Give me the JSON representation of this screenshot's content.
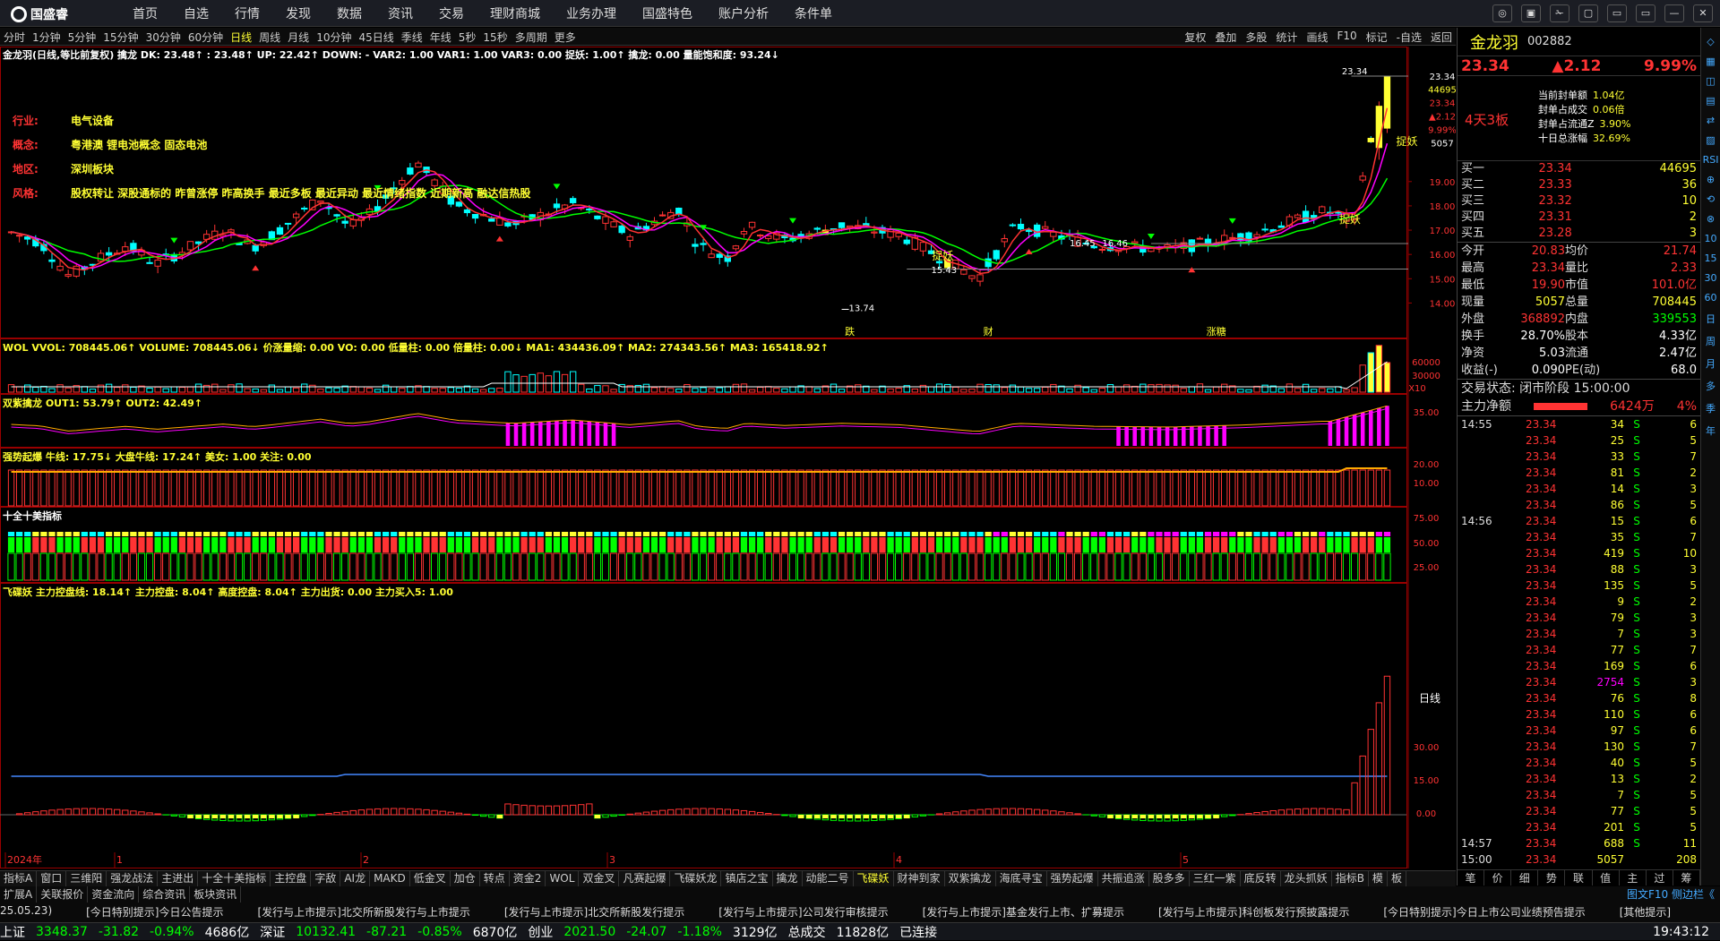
{
  "menu": {
    "app_name": "国盛睿",
    "items": [
      "首页",
      "自选",
      "行情",
      "发现",
      "数据",
      "资讯",
      "交易",
      "理财商城",
      "业务办理",
      "国盛特色",
      "账户分析",
      "条件单"
    ],
    "window_controls": [
      "◎",
      "▣",
      "✁",
      "▢",
      "▭",
      "▭",
      "—",
      "✕"
    ]
  },
  "toolbar": {
    "periods": [
      "分时",
      "1分钟",
      "5分钟",
      "15分钟",
      "30分钟",
      "60分钟",
      "日线",
      "周线",
      "月线",
      "10分钟",
      "45日线",
      "季线",
      "年线",
      "5秒",
      "15秒",
      "多周期",
      "更多"
    ],
    "active_period": "日线",
    "tools": [
      "复权",
      "叠加",
      "多股",
      "统计",
      "画线",
      "F10",
      "标记",
      "-自选",
      "返回"
    ]
  },
  "main_header": "金龙羽(日线,等比前复权)  擒龙  DK: 23.48↑ : 23.48↑ UP: 22.42↑ DOWN: - VAR2: 1.00 VAR1: 1.00 VAR3: 0.00 捉妖: 1.00↑ 擒龙: 0.00 量能饱和度: 93.24↓",
  "stock_info": [
    {
      "k": "行业:",
      "v": "电气设备"
    },
    {
      "k": "概念:",
      "v": "粤港澳 锂电池概念 固态电池"
    },
    {
      "k": "地区:",
      "v": "深圳板块"
    },
    {
      "k": "风格:",
      "v": "股权转让 深股通标的 昨曾涨停 昨高换手 最近多板 最近异动 最近情绪指数 近期新高 融达信热股"
    }
  ],
  "price_axis": [
    "23.34",
    "44695",
    "23.34",
    "▲2.12",
    "9.99%",
    "5057",
    "19.00",
    "18.00",
    "17.00",
    "16.00",
    "15.00",
    "14.00"
  ],
  "annotations": {
    "high": "23.34",
    "low": "13.74",
    "zhuoyao": "捉妖",
    "p1": "15.43",
    "p2": "16.45",
    "p3": "16.46",
    "events": [
      "跌",
      "财",
      "涨糖"
    ],
    "xaxis": [
      "2024年",
      "1",
      "2",
      "3",
      "4",
      "5"
    ],
    "right_label": "日线",
    "vol_x": "X10"
  },
  "indicators": [
    {
      "name": "WOL",
      "text": "WOL  VVOL: 708445.06↑ VOLUME: 708445.06↓ 价涨量缩: 0.00 VO: 0.00 低量柱: 0.00 倍量柱: 0.00↓ MA1: 434436.09↑ MA2: 274343.56↑ MA3: 165418.92↑",
      "axis": [
        "60000",
        "30000"
      ]
    },
    {
      "name": "双紫擒龙",
      "text": "双紫擒龙  OUT1: 53.79↑ OUT2: 42.49↑",
      "axis": [
        "35.00"
      ]
    },
    {
      "name": "强势起爆",
      "text": "强势起爆  牛线: 17.75↓ 大盘牛线: 17.24↑ 美女: 1.00 关注: 0.00",
      "axis": [
        "20.00",
        "10.00"
      ]
    },
    {
      "name": "十全十美指标",
      "text": "十全十美指标",
      "axis": [
        "75.00",
        "50.00",
        "25.00"
      ]
    },
    {
      "name": "飞碟妖",
      "text": "飞碟妖  主力控盘线: 18.14↑ 主力控盘: 8.04↑ 高度控盘: 8.04↑ 主力出货: 0.00 主力买入5: 1.00",
      "axis": [
        "30.00",
        "15.00",
        "0.00"
      ]
    }
  ],
  "func_tabs": [
    "指标A",
    "窗口",
    "三维阳",
    "强龙战法",
    "主进出",
    "十全十美指标",
    "主控盘",
    "字敌",
    "AI龙",
    "MAKD",
    "低金叉",
    "加仓",
    "转点",
    "资金2",
    "WOL",
    "双金叉",
    "凡赛起爆",
    "飞碟妖龙",
    "镇店之宝",
    "擒龙",
    "动能二号",
    "飞碟妖",
    "财神到家",
    "双紫擒龙",
    "海底寻宝",
    "强势起爆",
    "共振追涨",
    "股多多",
    "三红一紫",
    "底反转",
    "龙头抓妖",
    "指标B",
    "模",
    "板"
  ],
  "func_active": "飞碟妖",
  "news_tabs": [
    "扩展A",
    "关联报价",
    "资金流向",
    "综合资讯",
    "板块资讯"
  ],
  "news_active": "综合资讯",
  "news_date": "25.05.23)",
  "news": [
    "[今日特别提示]今日公告提示",
    "[发行与上市提示]北交所新股发行与上市提示",
    "[发行与上市提示]北交所新股发行提示",
    "[发行与上市提示]公司发行审核提示",
    "[发行与上市提示]基金发行上市、扩募提示",
    "[发行与上市提示]科创板发行预披露提示",
    "[今日特别提示]今日上市公司业绩预告提示",
    "[其他提示]"
  ],
  "news_right": "图文F10 侧边栏《",
  "status": [
    {
      "label": "上证",
      "val": "3348.37",
      "chg": "-31.82",
      "pct": "-0.94%",
      "amt": "4686亿"
    },
    {
      "label": "深证",
      "val": "10132.41",
      "chg": "-87.21",
      "pct": "-0.85%",
      "amt": "6870亿"
    },
    {
      "label": "创业",
      "val": "2021.50",
      "chg": "-24.07",
      "pct": "-1.18%",
      "amt": "3129亿"
    }
  ],
  "status_total": {
    "label": "总成交",
    "amt": "11828亿"
  },
  "status_conn": "已连接",
  "status_time": "19:43:12",
  "quote": {
    "name": "金龙羽",
    "code": "002882",
    "price": "23.34",
    "change": "▲2.12",
    "pct": "9.99%",
    "days_text": "4天3板",
    "seal": [
      {
        "k": "当前封单额",
        "v": "1.04亿"
      },
      {
        "k": "封单占成交",
        "v": "0.06倍"
      },
      {
        "k": "封单占流通Z",
        "v": "3.90%"
      },
      {
        "k": "十日总涨幅",
        "v": "32.69%"
      }
    ],
    "bids": [
      {
        "l": "买一",
        "p": "23.34",
        "v": "44695"
      },
      {
        "l": "买二",
        "p": "23.33",
        "v": "36"
      },
      {
        "l": "买三",
        "p": "23.32",
        "v": "10"
      },
      {
        "l": "买四",
        "p": "23.31",
        "v": "2"
      },
      {
        "l": "买五",
        "p": "23.28",
        "v": "3"
      }
    ],
    "stats": [
      [
        "今开",
        "20.83",
        "均价",
        "21.74"
      ],
      [
        "最高",
        "23.34",
        "量比",
        "2.33"
      ],
      [
        "最低",
        "19.90",
        "市值",
        "101.0亿"
      ],
      [
        "现量",
        "5057",
        "总量",
        "708445"
      ],
      [
        "外盘",
        "368892",
        "内盘",
        "339553"
      ],
      [
        "换手",
        "28.70%",
        "股本",
        "4.33亿"
      ],
      [
        "净资",
        "5.03",
        "流通",
        "2.47亿"
      ],
      [
        "收益(-)",
        "0.090",
        "PE(动)",
        "68.0"
      ]
    ],
    "state": "交易状态: 闭市阶段 15:00:00",
    "main_net": {
      "label": "主力净额",
      "val": "6424万",
      "pct": "4%"
    },
    "ticks": [
      [
        "14:55",
        "23.34",
        "34",
        "S",
        "6"
      ],
      [
        "",
        "23.34",
        "25",
        "S",
        "5"
      ],
      [
        "",
        "23.34",
        "33",
        "S",
        "7"
      ],
      [
        "",
        "23.34",
        "81",
        "S",
        "2"
      ],
      [
        "",
        "23.34",
        "14",
        "S",
        "3"
      ],
      [
        "",
        "23.34",
        "86",
        "S",
        "5"
      ],
      [
        "14:56",
        "23.34",
        "15",
        "S",
        "6"
      ],
      [
        "",
        "23.34",
        "35",
        "S",
        "7"
      ],
      [
        "",
        "23.34",
        "419",
        "S",
        "10"
      ],
      [
        "",
        "23.34",
        "88",
        "S",
        "3"
      ],
      [
        "",
        "23.34",
        "135",
        "S",
        "5"
      ],
      [
        "",
        "23.34",
        "9",
        "S",
        "2"
      ],
      [
        "",
        "23.34",
        "79",
        "S",
        "3"
      ],
      [
        "",
        "23.34",
        "7",
        "S",
        "3"
      ],
      [
        "",
        "23.34",
        "77",
        "S",
        "7"
      ],
      [
        "",
        "23.34",
        "169",
        "S",
        "6"
      ],
      [
        "",
        "23.34",
        "2754",
        "S",
        "3"
      ],
      [
        "",
        "23.34",
        "76",
        "S",
        "8"
      ],
      [
        "",
        "23.34",
        "110",
        "S",
        "6"
      ],
      [
        "",
        "23.34",
        "97",
        "S",
        "6"
      ],
      [
        "",
        "23.34",
        "130",
        "S",
        "7"
      ],
      [
        "",
        "23.34",
        "40",
        "S",
        "5"
      ],
      [
        "",
        "23.34",
        "13",
        "S",
        "2"
      ],
      [
        "",
        "23.34",
        "7",
        "S",
        "5"
      ],
      [
        "",
        "23.34",
        "77",
        "S",
        "5"
      ],
      [
        "",
        "23.34",
        "201",
        "S",
        "5"
      ],
      [
        "14:57",
        "23.34",
        "688",
        "S",
        "11"
      ],
      [
        "15:00",
        "23.34",
        "5057",
        "",
        "208"
      ]
    ],
    "foot": [
      "笔",
      "价",
      "细",
      "势",
      "联",
      "值",
      "主",
      "过",
      "筹"
    ]
  },
  "side_strip": [
    "◇",
    "▦",
    "◫",
    "▤",
    "⇄",
    "▨",
    "RSI",
    "⊕",
    "⟲",
    "⊗",
    "10",
    "15",
    "30",
    "60",
    "日",
    "周",
    "月",
    "多",
    "季",
    "年"
  ],
  "colors": {
    "up": "#ff3333",
    "down": "#00ff00",
    "ma1": "#ff00ff",
    "ma2": "#00ff00",
    "yellow": "#ffff33",
    "cyan": "#00ffff"
  }
}
